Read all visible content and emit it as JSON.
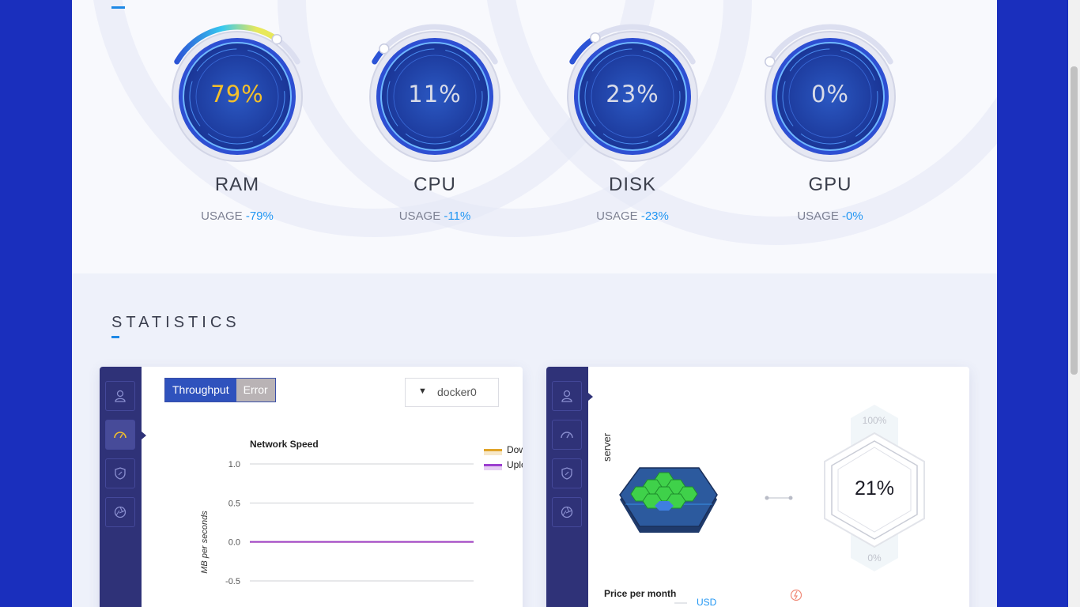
{
  "gauges": [
    {
      "name": "RAM",
      "value": "79%",
      "usage_label": "USAGE",
      "usage_value": "-79%",
      "percent": 79,
      "value_color": "#f5c02a"
    },
    {
      "name": "CPU",
      "value": "11%",
      "usage_label": "USAGE",
      "usage_value": "-11%",
      "percent": 11,
      "value_color": "#d9dce8"
    },
    {
      "name": "DISK",
      "value": "23%",
      "usage_label": "USAGE",
      "usage_value": "-23%",
      "percent": 23,
      "value_color": "#d9dce8"
    },
    {
      "name": "GPU",
      "value": "0%",
      "usage_label": "USAGE",
      "usage_value": "-0%",
      "percent": 0,
      "value_color": "#d9dce8"
    }
  ],
  "statistics": {
    "title": "STATISTICS",
    "network_card": {
      "tabs": [
        {
          "label": "Throughput",
          "active": true
        },
        {
          "label": "Error",
          "active": false
        }
      ],
      "interface_select": "docker0",
      "chart_data": {
        "type": "line",
        "title": "Network Speed",
        "ylabel": "MB per seconds",
        "xlabel": "",
        "y_ticks": [
          "1.0",
          "0.5",
          "0.0",
          "-0.5"
        ],
        "ylim": [
          -0.5,
          1.0
        ],
        "series": [
          {
            "name": "Downloa",
            "color": "#e0a42a",
            "values": [
              0,
              0
            ]
          },
          {
            "name": "Upload",
            "color": "#9c3fcf",
            "values": [
              0,
              0
            ]
          }
        ],
        "legend_position": "right",
        "grid": true
      }
    },
    "server_card": {
      "vertical_label": "server",
      "hex_value": "21%",
      "hex_top_label": "100%",
      "hex_bottom_label": "0%",
      "price_label": "Price per month",
      "currency_label": "USD"
    }
  },
  "colors": {
    "accent": "#1e88e5",
    "sidebar": "#2f3278",
    "page_bg": "#1a2fbd"
  },
  "sidebar_icons": [
    "user-icon",
    "speedometer-icon",
    "shield-icon",
    "aperture-icon"
  ]
}
